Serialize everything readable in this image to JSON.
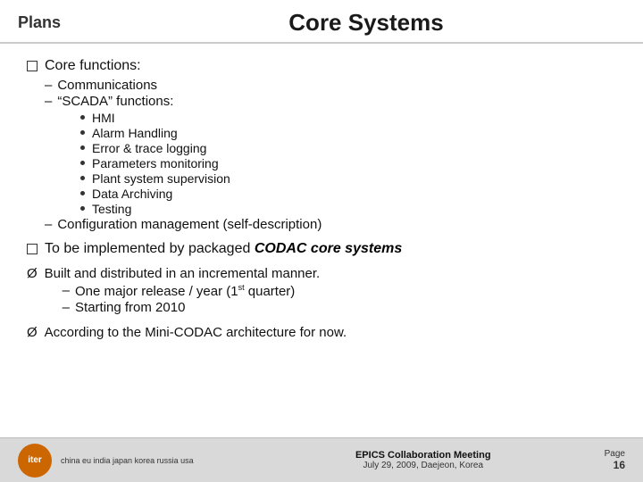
{
  "header": {
    "left_label": "Plans",
    "title": "Core Systems"
  },
  "section1": {
    "label": "Core functions:",
    "sub_items": [
      {
        "text": "Communications"
      },
      {
        "text": "“SCADA” functions:"
      }
    ],
    "bullets": [
      {
        "text": "HMI"
      },
      {
        "text": "Alarm Handling"
      },
      {
        "text": "Error & trace logging"
      },
      {
        "text": "Parameters monitoring"
      },
      {
        "text": "Plant system supervision"
      },
      {
        "text": "Data Archiving"
      },
      {
        "text": "Testing"
      }
    ],
    "config_item": "Configuration management (self-description)"
  },
  "section2": {
    "label": "To be implemented by packaged ",
    "codac_text": "CODAC core systems"
  },
  "section3": {
    "label": "Built and distributed in an incremental manner.",
    "sub_items": [
      {
        "text": "One major release / year (1",
        "sup": "st",
        "suffix": " quarter)"
      },
      {
        "text": "Starting from 2010"
      }
    ]
  },
  "section4": {
    "label": "According to the Mini-CODAC architecture for now."
  },
  "footer": {
    "logo_text": "iter",
    "countries": "china eu india japan korea russia usa",
    "conference": "EPICS Collaboration Meeting",
    "location": "July 29, 2009, Daejeon, Korea",
    "page_label": "Page",
    "page_number": "16"
  }
}
